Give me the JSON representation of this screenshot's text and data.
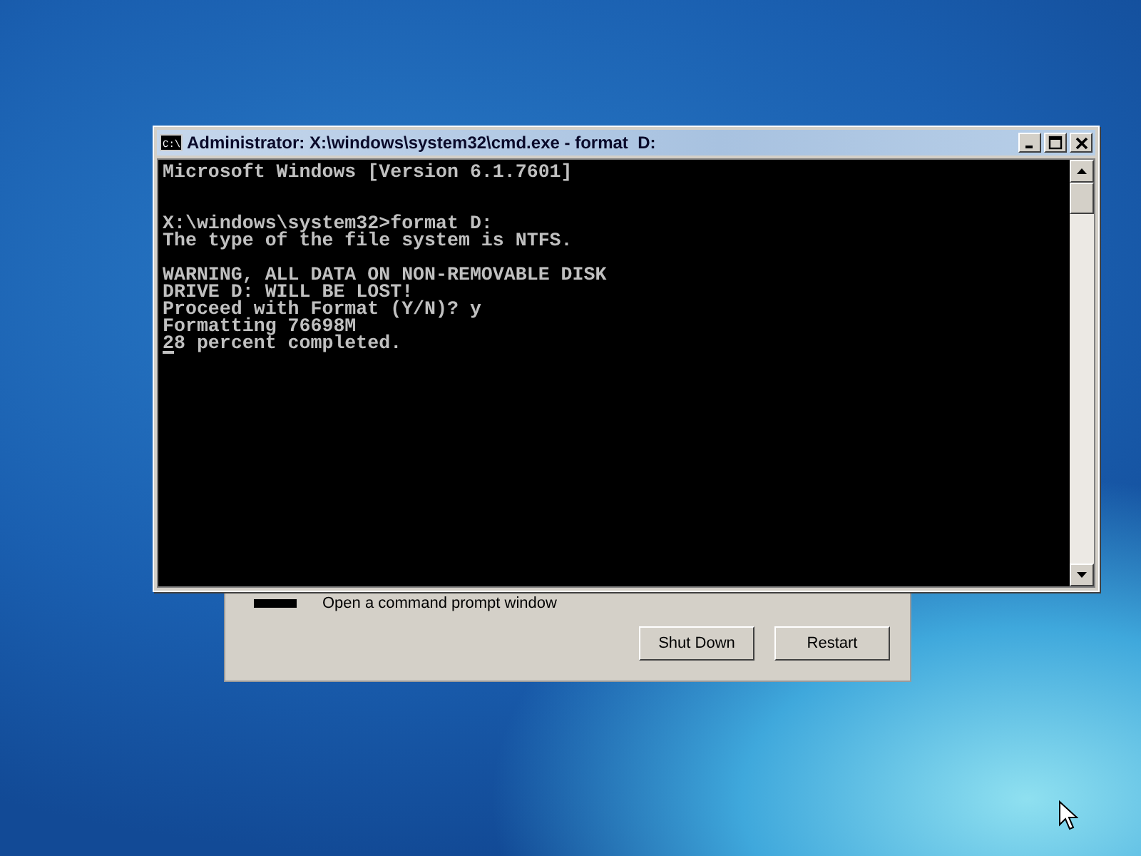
{
  "background_dialog": {
    "option_text": "Open a command prompt window",
    "buttons": [
      {
        "label": "Shut Down"
      },
      {
        "label": "Restart"
      }
    ]
  },
  "console_window": {
    "icon_text": "C:\\",
    "title": "Administrator: X:\\windows\\system32\\cmd.exe - format  D:",
    "lines": [
      {
        "kind": "text",
        "text": "Microsoft Windows [Version 6.1.7601]"
      },
      {
        "kind": "blank"
      },
      {
        "kind": "blank"
      },
      {
        "kind": "text",
        "text": "X:\\windows\\system32>format D:"
      },
      {
        "kind": "text",
        "text": "The type of the file system is NTFS."
      },
      {
        "kind": "blank"
      },
      {
        "kind": "text",
        "text": "WARNING, ALL DATA ON NON-REMOVABLE DISK"
      },
      {
        "kind": "text",
        "text": "DRIVE D: WILL BE LOST!"
      },
      {
        "kind": "text",
        "text": "Proceed with Format (Y/N)? y"
      },
      {
        "kind": "text",
        "text": "Formatting 76698M"
      },
      {
        "kind": "cursor",
        "text": "28 percent completed."
      }
    ]
  }
}
